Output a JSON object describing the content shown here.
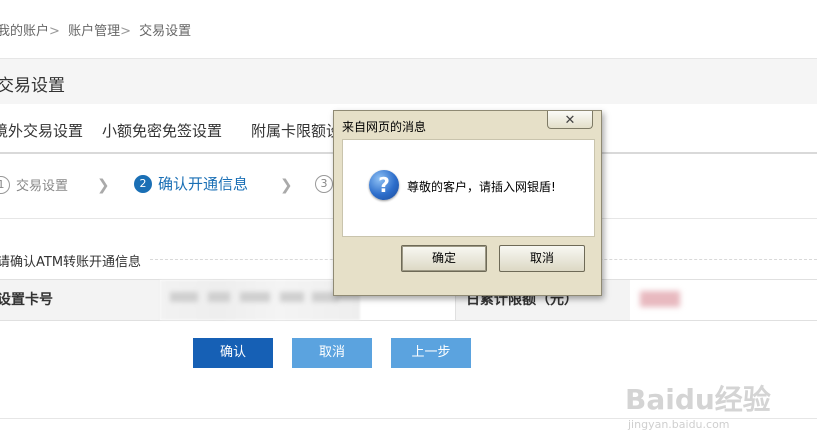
{
  "breadcrumb": {
    "items": [
      "我的账户",
      "账户管理",
      "交易设置"
    ],
    "separator": ">"
  },
  "page": {
    "title": "交易设置"
  },
  "tabs": [
    {
      "label": "境外交易设置"
    },
    {
      "label": "小额免密免签设置"
    },
    {
      "label": "附属卡限额设"
    }
  ],
  "steps": [
    {
      "num": "1",
      "label": "交易设置",
      "active": false
    },
    {
      "num": "2",
      "label": "确认开通信息",
      "active": true
    },
    {
      "num": "3",
      "label": "",
      "active": false
    }
  ],
  "section": {
    "title": "请确认ATM转账开通信息"
  },
  "form_row": {
    "card_label": "设置卡号",
    "limit_label": "日累计限额（元）"
  },
  "buttons": {
    "confirm": "确认",
    "cancel": "取消",
    "prev": "上一步"
  },
  "dialog": {
    "title": "来自网页的消息",
    "close": "✕",
    "icon": "question-icon",
    "message": "尊敬的客户，请插入网银盾!",
    "ok": "确定",
    "cancel": "取消"
  },
  "watermark": {
    "text": "Baidu经验",
    "sub": "jingyan.baidu.com"
  },
  "colors": {
    "primary_button": "#1660b5",
    "secondary_button": "#5ba3df",
    "active_step": "#1a6fb5",
    "dialog_frame": "#e6e0c8"
  }
}
